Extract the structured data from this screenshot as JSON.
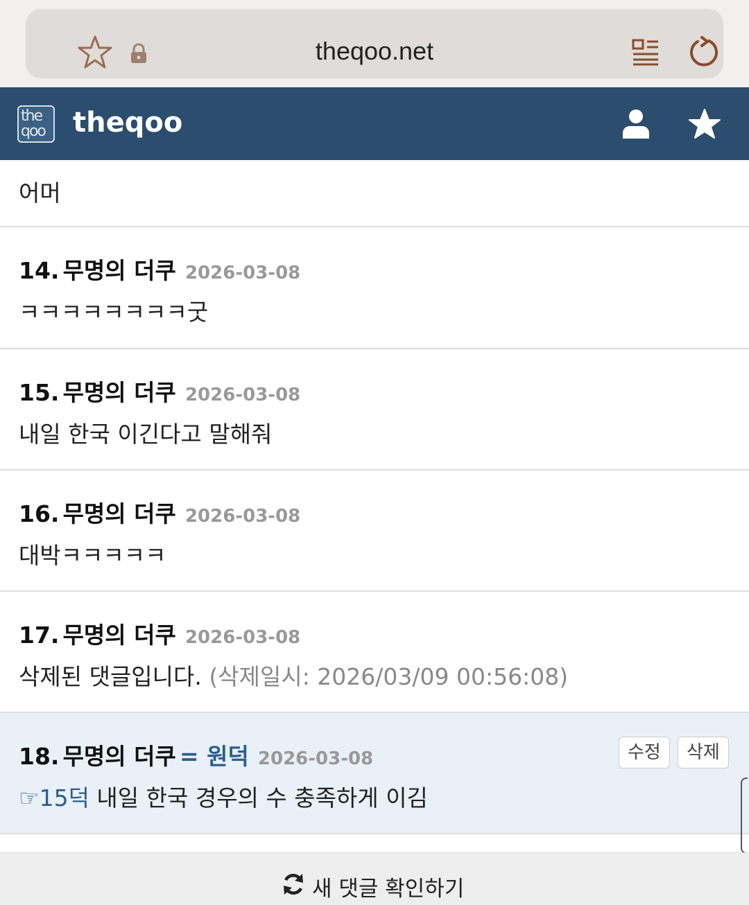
{
  "browser": {
    "url": "theqoo.net",
    "icons": [
      "star-outline-icon",
      "lock-icon",
      "reader-mode-icon",
      "reload-icon"
    ]
  },
  "header": {
    "logo_top": "the",
    "logo_bottom": "qoo",
    "site_name": "theqoo",
    "icons": [
      "user-icon",
      "star-icon"
    ],
    "bg_color": "#2b4d6e"
  },
  "first_comment_body": "어머",
  "comments": [
    {
      "num": "14.",
      "author": "무명의 더쿠",
      "date": "2026-03-08",
      "body": "ㅋㅋㅋㅋㅋㅋㅋㅋ굿"
    },
    {
      "num": "15.",
      "author": "무명의 더쿠",
      "date": "2026-03-08",
      "body": "내일 한국 이긴다고 말해줘"
    },
    {
      "num": "16.",
      "author": "무명의 더쿠",
      "date": "2026-03-08",
      "body": "대박ㅋㅋㅋㅋㅋ"
    },
    {
      "num": "17.",
      "author": "무명의 더쿠",
      "date": "2026-03-08",
      "body": "삭제된 댓글입니다.",
      "deleted_meta": "(삭제일시: 2026/03/09 00:56:08)"
    },
    {
      "num": "18.",
      "author": "무명의 더쿠",
      "op_mark": "= 원덕",
      "date": "2026-03-08",
      "reply_ref": "☞15덕",
      "body": " 내일 한국 경우의 수 충족하게 이김",
      "edit_label": "수정",
      "delete_label": "삭제"
    }
  ],
  "bottom_bar": {
    "label": "새 댓글 확인하기"
  },
  "colors": {
    "accent": "#2b5d8e",
    "highlight_bg": "#e9f0f8",
    "date_gray": "#999999"
  }
}
